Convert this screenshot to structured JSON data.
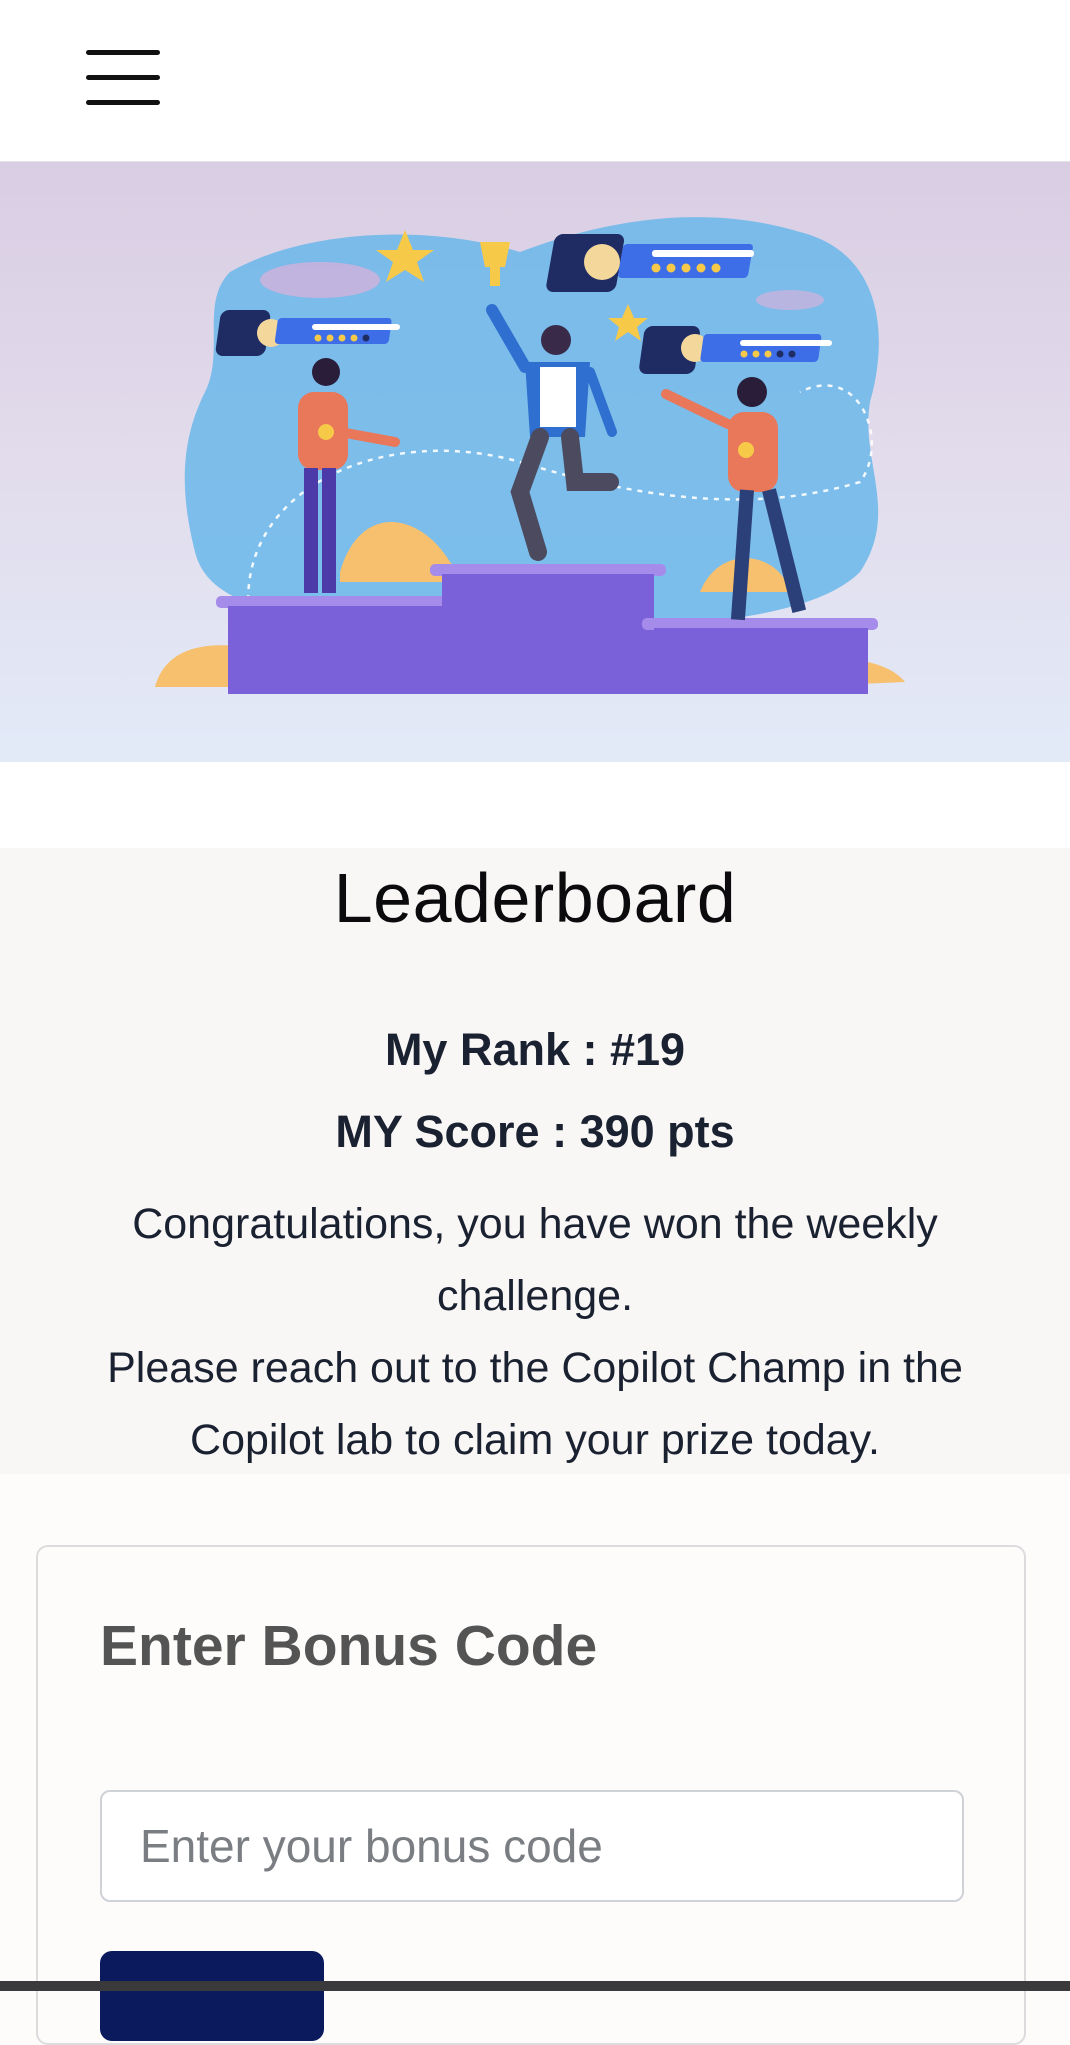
{
  "header": {
    "menu_icon": "hamburger-menu-icon"
  },
  "hero": {
    "illustration": "leaderboard-winners-podium-illustration",
    "colors": {
      "podium": "#7b61d9",
      "blob": "#6ab7ea",
      "sand": "#f6c06f",
      "star": "#f7c948"
    }
  },
  "leaderboard": {
    "title": "Leaderboard",
    "rank_text": "My Rank : #19",
    "score_text": "MY Score : 390 pts",
    "message_line1": "Congratulations, you have won the weekly challenge.",
    "message_line2": "Please reach out to the Copilot Champ in the Copilot lab to claim your prize today."
  },
  "bonus": {
    "title": "Enter Bonus Code",
    "input_placeholder": "Enter your bonus code",
    "input_value": ""
  },
  "colors": {
    "text_dark": "#1a2130",
    "button_bg": "#0b1a5c",
    "card_title": "#545454"
  }
}
